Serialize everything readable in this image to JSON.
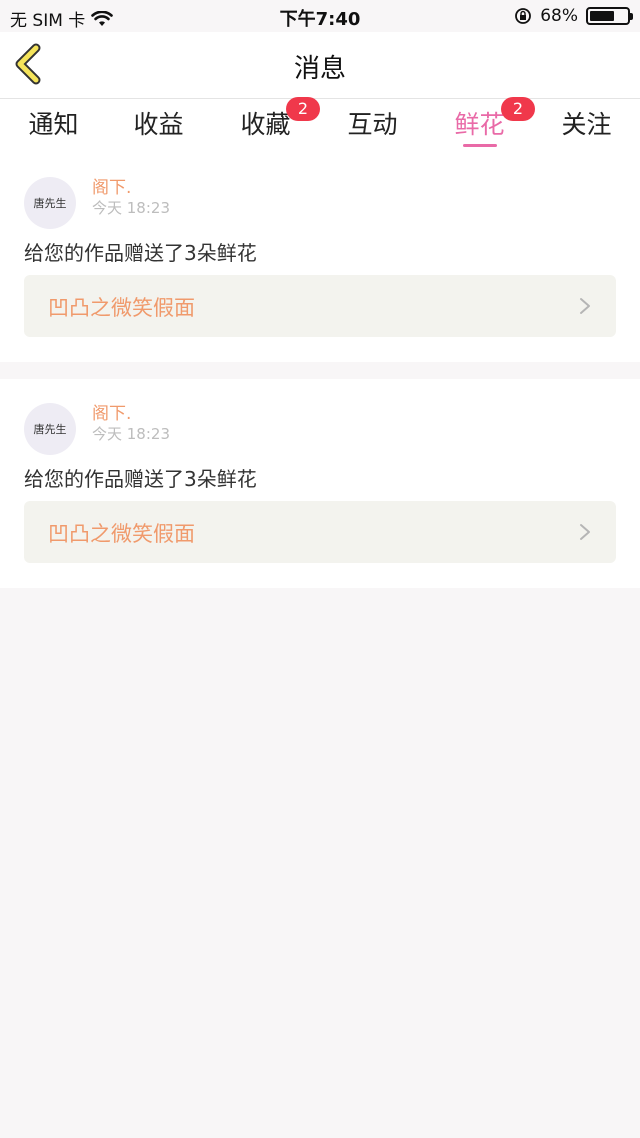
{
  "status_bar": {
    "carrier": "无 SIM 卡",
    "time": "下午7:40",
    "battery_percent": "68%",
    "battery_level": 0.68
  },
  "nav": {
    "title": "消息"
  },
  "tabs": [
    {
      "label": "通知",
      "badge": null
    },
    {
      "label": "收益",
      "badge": null
    },
    {
      "label": "收藏",
      "badge": "2"
    },
    {
      "label": "互动",
      "badge": null
    },
    {
      "label": "鲜花",
      "badge": "2",
      "active": true
    },
    {
      "label": "关注",
      "badge": null
    }
  ],
  "messages": [
    {
      "avatar_text": "唐先生",
      "username": "阁下.",
      "time": "今天 18:23",
      "text": "给您的作品赠送了3朵鲜花",
      "work_title": "凹凸之微笑假面"
    },
    {
      "avatar_text": "唐先生",
      "username": "阁下.",
      "time": "今天 18:23",
      "text": "给您的作品赠送了3朵鲜花",
      "work_title": "凹凸之微笑假面"
    }
  ],
  "colors": {
    "accent_pink": "#e96aa7",
    "badge_red": "#f0384b",
    "username_orange": "#f09a6c",
    "back_icon_yellow": "#f5e45a"
  }
}
